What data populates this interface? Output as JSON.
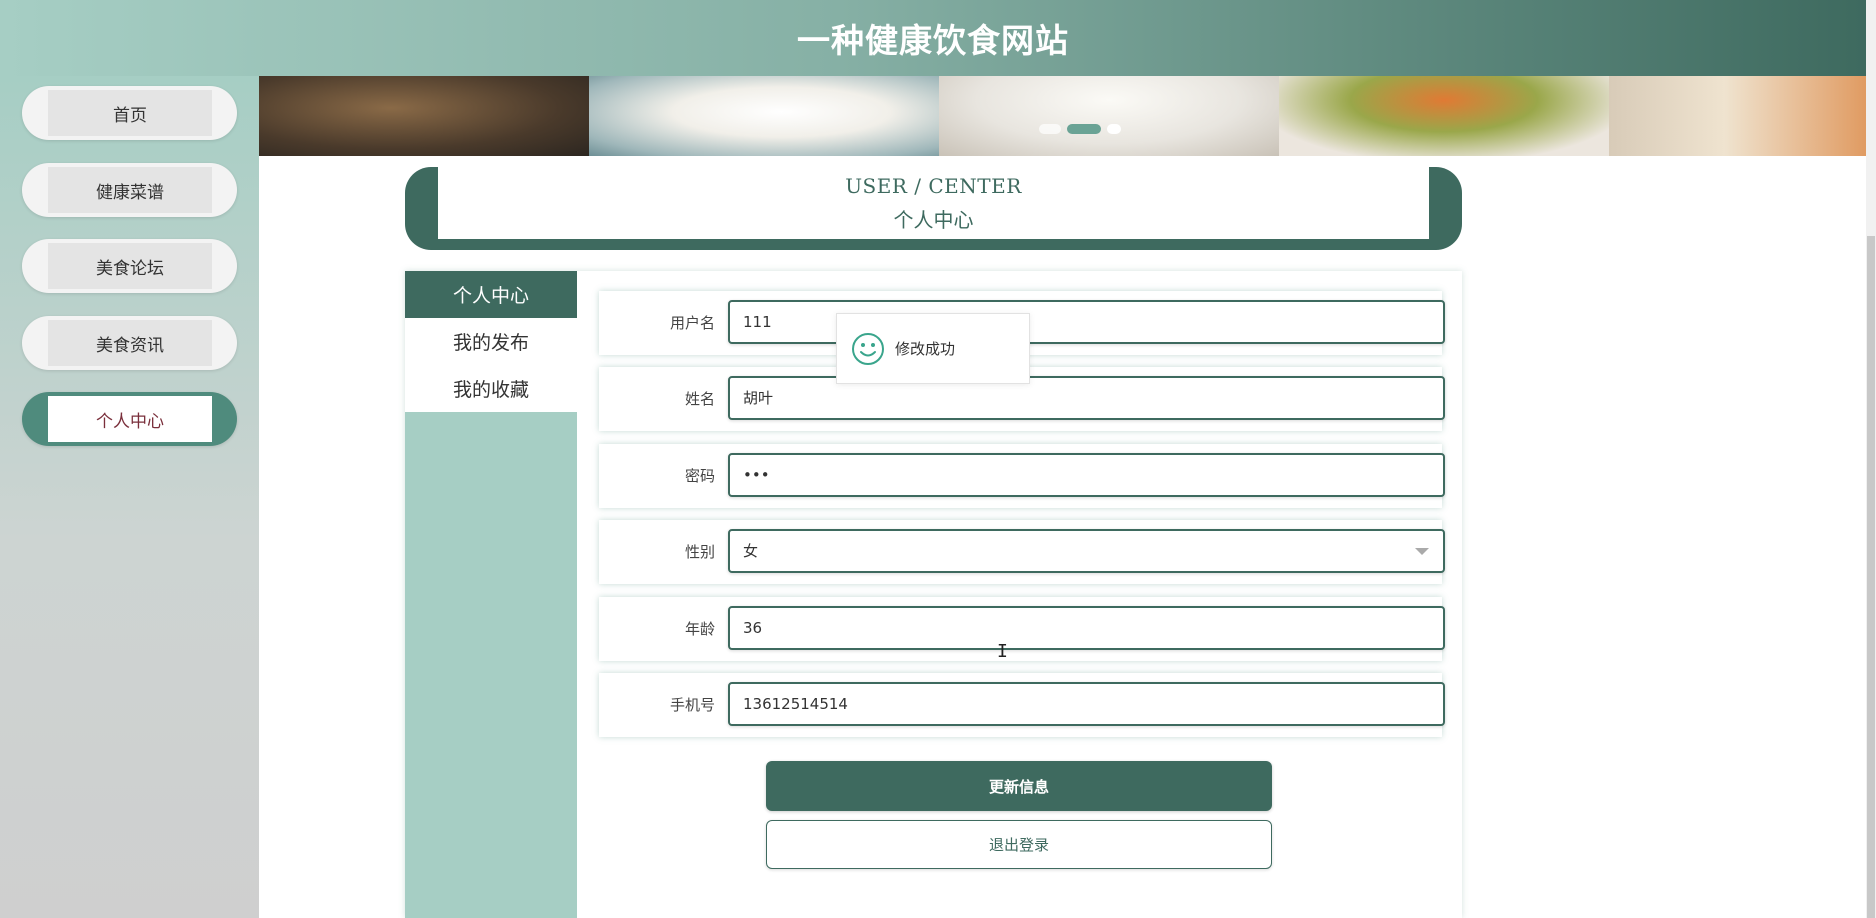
{
  "header": {
    "title": "一种健康饮食网站"
  },
  "nav": {
    "items": [
      {
        "label": "首页"
      },
      {
        "label": "健康菜谱"
      },
      {
        "label": "美食论坛"
      },
      {
        "label": "美食资讯"
      },
      {
        "label": "个人中心"
      }
    ],
    "active": "个人中心"
  },
  "banner": {
    "slides_count": 3,
    "active_slide": 2
  },
  "user_center": {
    "title_en": "USER / CENTER",
    "title_cn": "个人中心"
  },
  "side_menu": {
    "items": [
      {
        "label": "个人中心"
      },
      {
        "label": "我的发布"
      },
      {
        "label": "我的收藏"
      }
    ]
  },
  "form": {
    "username": {
      "label": "用户名",
      "value": "111"
    },
    "name": {
      "label": "姓名",
      "value": "胡叶"
    },
    "password": {
      "label": "密码",
      "value": "•••"
    },
    "gender": {
      "label": "性别",
      "value": "女"
    },
    "age": {
      "label": "年龄",
      "value": "36"
    },
    "phone": {
      "label": "手机号",
      "value": "13612514514"
    }
  },
  "buttons": {
    "update": "更新信息",
    "logout": "退出登录"
  },
  "toast": {
    "message": "修改成功",
    "icon": "smile-icon"
  },
  "colors": {
    "primary": "#3e6a5f",
    "light": "#a6cec4",
    "active_text": "#7a2f3b"
  }
}
